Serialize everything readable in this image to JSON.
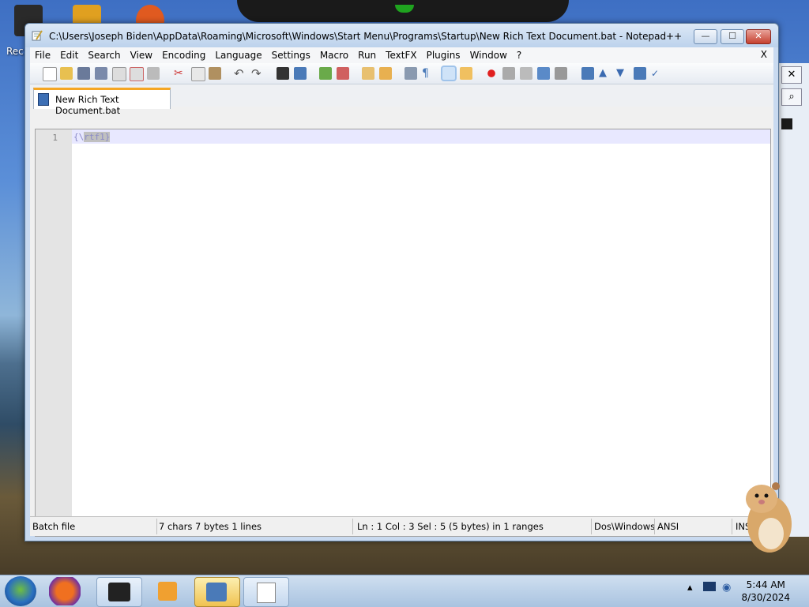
{
  "desktop": {
    "label": "Rec"
  },
  "window": {
    "title": "C:\\Users\\Joseph Biden\\AppData\\Roaming\\Microsoft\\Windows\\Start Menu\\Programs\\Startup\\New Rich Text Document.bat - Notepad++",
    "buttons": {
      "minimize": "—",
      "maximize": "☐",
      "close": "✕"
    }
  },
  "menu": {
    "items": [
      "File",
      "Edit",
      "Search",
      "View",
      "Encoding",
      "Language",
      "Settings",
      "Macro",
      "Run",
      "TextFX",
      "Plugins",
      "Window",
      "?"
    ],
    "close": "X"
  },
  "tab": {
    "label": "New Rich Text Document.bat"
  },
  "editor": {
    "line_number": "1",
    "code_prefix": "{\\",
    "code_selected": "rtf1}"
  },
  "status": {
    "filetype": "Batch file",
    "length": "7 chars   7 bytes   1 lines",
    "position": "Ln : 1    Col : 3    Sel : 5 (5 bytes) in 1 ranges",
    "eol": "Dos\\Windows",
    "encoding": "ANSI",
    "mode": "INS"
  },
  "taskbar": {
    "time": "5:44 AM",
    "date": "8/30/2024"
  }
}
